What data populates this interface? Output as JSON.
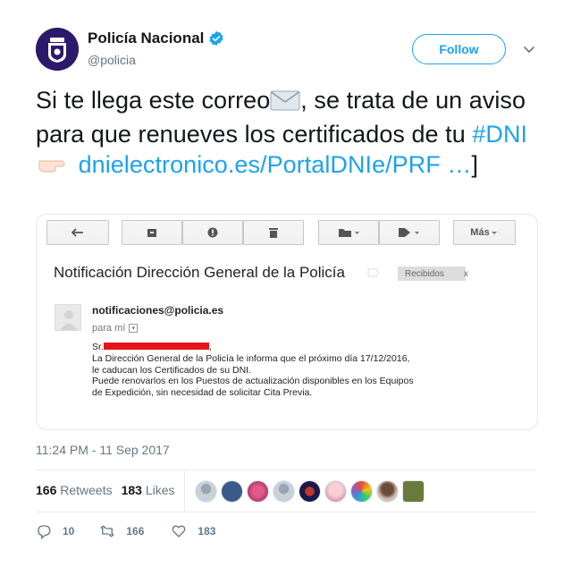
{
  "author": {
    "name": "Policía Nacional",
    "handle": "@policia",
    "verified": true
  },
  "follow_label": "Follow",
  "tweet": {
    "text_1": "Si te llega este correo",
    "text_2": ", se trata de un aviso para que renueves los certificados de tu ",
    "hashtag": "#DNI",
    "link": "dnielectronico.es/PortalDNIe/PRF …",
    "closing": "]",
    "emoji_1": "envelope-emoji",
    "emoji_2": "pointing-right-emoji"
  },
  "email_card": {
    "more_label": "Más",
    "subject": "Notificación Dirección General de la Policía",
    "label": "Recibidos",
    "label_close": "x",
    "sender": "notificaciones@policia.es",
    "to": "para mí",
    "greeting": "Sr.",
    "body_lines": [
      "La Dirección General de la Policía le informa que el próximo día 17/12/2016,",
      "le caducan los Certificados de su DNI.",
      "Puede renovarlos en los Puestos de actualización disponibles en los Equipos",
      "de Expedición, sin necesidad de solicitar Cita Previa."
    ]
  },
  "timestamp": "11:24 PM - 11 Sep 2017",
  "stats": {
    "retweets_count": "166",
    "retweets_label": "Retweets",
    "likes_count": "183",
    "likes_label": "Likes"
  },
  "actions": {
    "replies": "10",
    "retweets": "166",
    "likes": "183"
  },
  "colors": {
    "accent": "#1da1f2",
    "text": "#14171a",
    "muted": "#657786",
    "redaction": "#e8141c"
  }
}
